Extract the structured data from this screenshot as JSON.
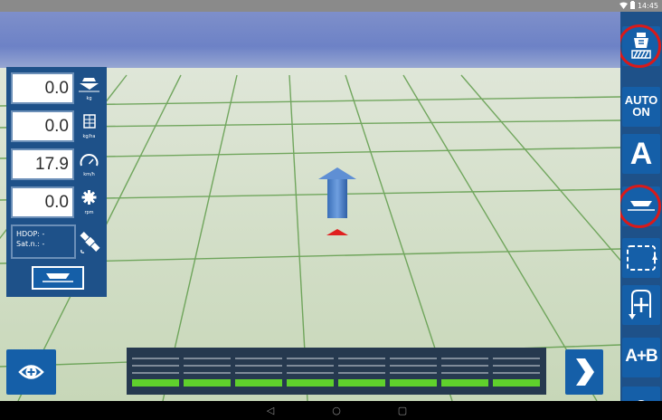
{
  "status_bar": {
    "time": "14:45",
    "icons": [
      "wifi-icon",
      "battery-icon"
    ]
  },
  "left_panel": {
    "readouts": [
      {
        "value": "0.0",
        "unit": "kg",
        "icon": "spreader-hopper-icon"
      },
      {
        "value": "0.0",
        "unit": "kg/ha",
        "icon": "area-grid-icon"
      },
      {
        "value": "17.9",
        "unit": "km/h",
        "icon": "speedometer-icon"
      },
      {
        "value": "0.0",
        "unit": "rpm",
        "icon": "gear-icon"
      }
    ],
    "gps": {
      "hdop_label": "HDOP: -",
      "sat_label": "Sat.n.: -",
      "icon": "satellite-icon"
    },
    "boom_icon": "spreader-boom-icon"
  },
  "right_toolbar": {
    "buttons": [
      {
        "name": "machine-control",
        "icon": "spreader-machine-icon",
        "highlighted": true
      },
      {
        "name": "auto",
        "line1": "AUTO",
        "line2": "ON"
      },
      {
        "name": "guidance-a",
        "label": "A"
      },
      {
        "name": "spreader-toggle",
        "icon": "spreader-boom-icon",
        "highlighted": true
      },
      {
        "name": "boundary",
        "icon": "boundary-dashed-icon"
      },
      {
        "name": "headland",
        "icon": "headland-turn-icon"
      },
      {
        "name": "ab-line",
        "label": "A+B"
      },
      {
        "name": "more",
        "icon": "search-icon"
      }
    ],
    "highlight_color": "#d91a1a"
  },
  "bottom": {
    "view_button_icon": "eye-icon",
    "next_button_icon": "chevron-right-icon",
    "sections": {
      "count": 8,
      "active_color": "#5fd02c",
      "line_color": "#d8dde3"
    }
  },
  "vehicle": {
    "icon": "direction-arrow-icon",
    "marker_color": "#e02020"
  },
  "nav_bar": {
    "back": "◁",
    "home": "○",
    "recents": "▢"
  },
  "colors": {
    "accent": "#155fa8",
    "panel": "#1e5189",
    "field": "#d2ddc8",
    "grid_line": "#5f9c4a"
  }
}
